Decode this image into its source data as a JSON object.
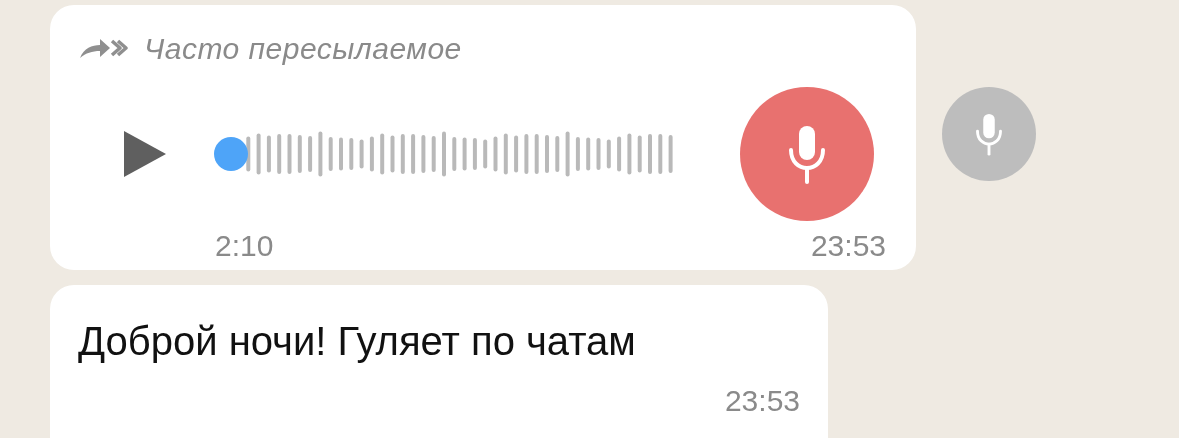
{
  "messages": [
    {
      "kind": "voice",
      "forwarded_label": "Часто пересылаемое",
      "playing": false,
      "duration": "2:10",
      "time": "23:53"
    },
    {
      "kind": "text",
      "text": "Доброй ночи! Гуляет по чатам",
      "time": "23:53"
    }
  ]
}
